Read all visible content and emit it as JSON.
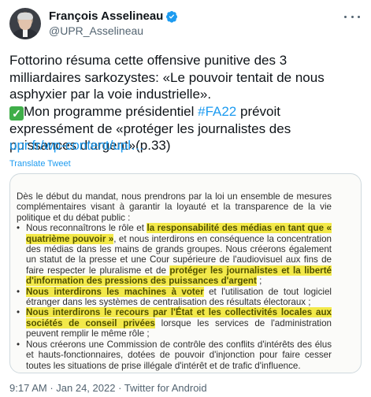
{
  "author": {
    "name": "François Asselineau",
    "handle": "@UPR_Asselineau",
    "verified": true
  },
  "tweet": {
    "line1": "Fottorino résuma cette offensive punitive des 3",
    "line2": "milliardaires sarkozystes: «Le pouvoir tentait de nous",
    "line3": "asphyxier par la voie industrielle».",
    "line4_pre": "Mon programme présidentiel ",
    "hashtag": "#FA22",
    "line4_post": " prévoit",
    "line5": "expressément de «protéger les journalistes des",
    "line6": "puissances d'argent»(p.33)",
    "link": "upr.fr/wp-content/upl…",
    "translate": "Translate Tweet",
    "check_glyph": "✓"
  },
  "document": {
    "intro": "Dès le début du mandat, nous prendrons par la loi un ensemble de mesures complémentaires visant à garantir la loyauté et la transparence de la vie politique et du débat public :",
    "b1_a": "Nous reconnaîtrons le rôle et ",
    "b1_hl1": "la responsabilité des médias en tant que « quatrième pouvoir »",
    "b1_b": ", et nous interdirons en conséquence la concentration des médias dans les mains de grands groupes. Nous créerons également un statut de la presse et une Cour supérieure de l'audiovisuel aux fins de faire respecter le pluralisme et de ",
    "b1_hl2": "protéger les journalistes et la liberté d'information des pressions des puissances d'argent",
    "b1_c": " ;",
    "b2_hl": "Nous interdirons les machines à voter",
    "b2_a": " et l'utilisation de tout logiciel étranger dans les systèmes de centralisation des résultats électoraux ;",
    "b3_hl": "Nous interdirons le recours par l'État et les collectivités locales aux sociétés de conseil privées",
    "b3_a": " lorsque les services de l'administration peuvent remplir le même rôle ;",
    "b4_a": "Nous créerons une Commission de contrôle des conflits d'intérêts des élus et hauts-fonctionnaires, dotées de pouvoir d'injonction pour faire cesser toutes les situations de prise illégale d'intérêt et de trafic d'influence."
  },
  "meta": {
    "time": "9:17 AM",
    "sep1": " · ",
    "date": "Jan 24, 2022",
    "sep2": " · ",
    "source": "Twitter for Android"
  },
  "colors": {
    "link": "#1d9bf0",
    "secondary_text": "#536471",
    "highlight": "#f3e94a",
    "check": "#3fae49"
  },
  "icons": [
    "verified-badge-icon",
    "more-options-icon",
    "check-mark-icon"
  ]
}
